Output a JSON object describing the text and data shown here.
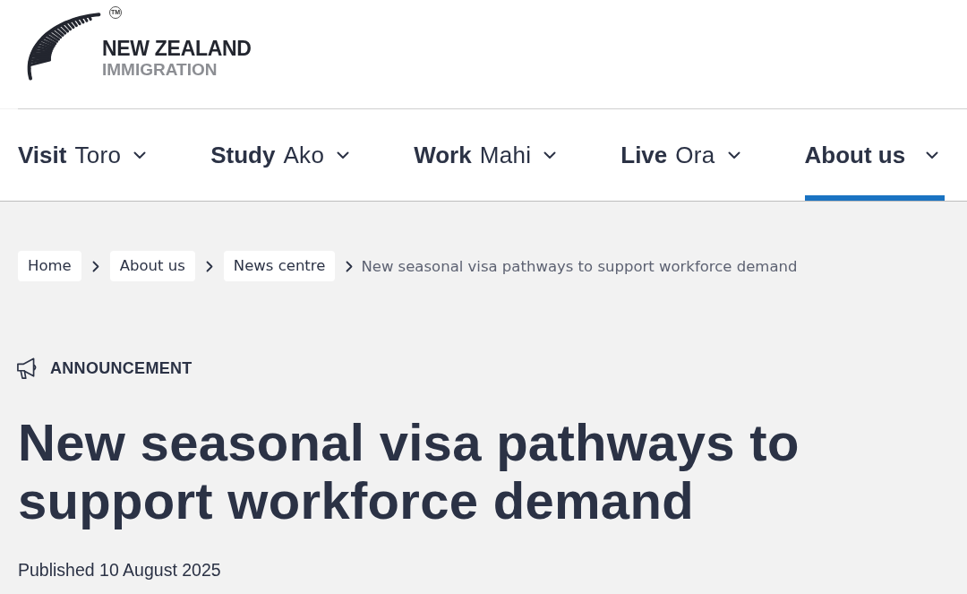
{
  "logo": {
    "line_1": "NEW ZEALAND",
    "line_2": "IMMIGRATION",
    "trademark": "TM"
  },
  "nav": {
    "items": [
      {
        "label": "Visit",
        "translation": "Toro",
        "selected": false
      },
      {
        "label": "Study",
        "translation": "Ako",
        "selected": false
      },
      {
        "label": "Work",
        "translation": "Mahi",
        "selected": false
      },
      {
        "label": "Live",
        "translation": "Ora",
        "selected": false
      },
      {
        "label": "About us",
        "selected": true
      }
    ]
  },
  "breadcrumbs": [
    {
      "label": "Home",
      "kind": "link"
    },
    {
      "label": "About us",
      "kind": "link"
    },
    {
      "label": "News centre",
      "kind": "link"
    },
    {
      "label": "New seasonal visa pathways to support workforce demand",
      "kind": "current"
    }
  ],
  "article": {
    "category": "ANNOUNCEMENT",
    "title": "New seasonal visa pathways to support workforce demand",
    "published": "Published 10 August 2025"
  }
}
